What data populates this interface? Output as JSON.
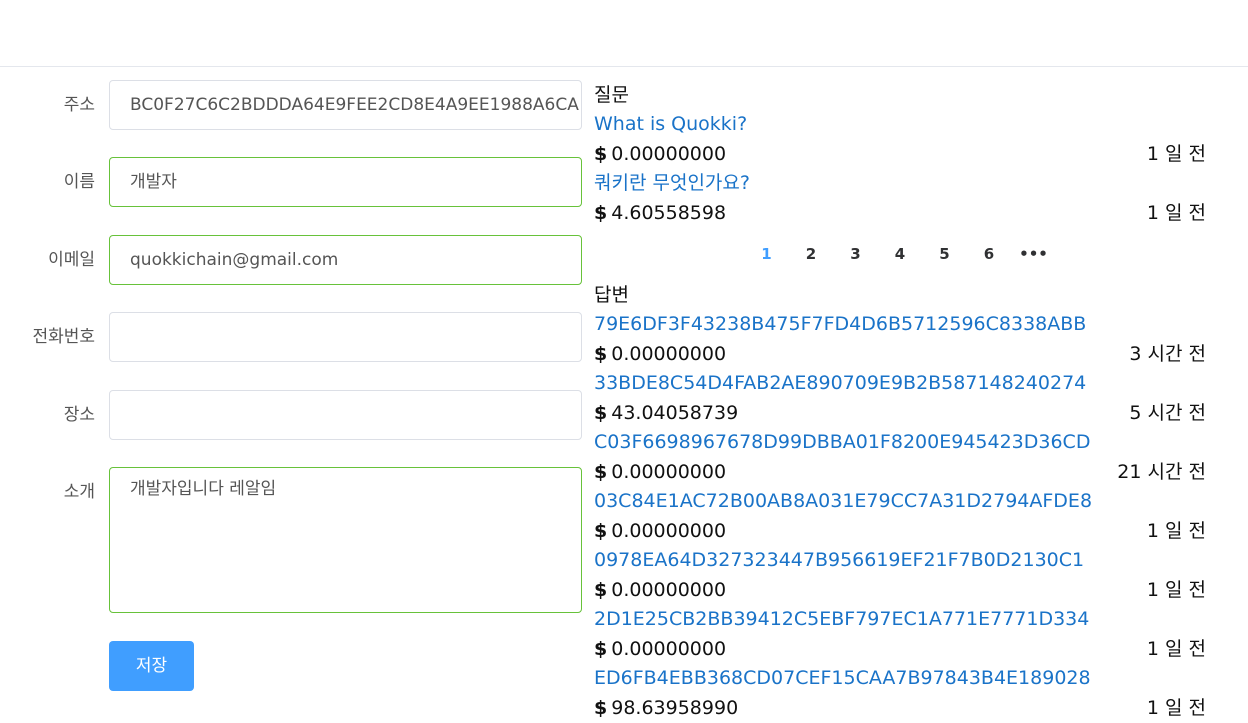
{
  "form": {
    "address_label": "주소",
    "address_value": "BC0F27C6C2BDDDA64E9FEE2CD8E4A9EE1988A6CA",
    "name_label": "이름",
    "name_value": "개발자",
    "email_label": "이메일",
    "email_value": "quokkichain@gmail.com",
    "phone_label": "전화번호",
    "phone_value": "",
    "place_label": "장소",
    "place_value": "",
    "intro_label": "소개",
    "intro_value": "개발자입니다 레알임",
    "save_label": "저장"
  },
  "questions": {
    "title": "질문",
    "items": [
      {
        "title": "What is Quokki?",
        "amount": "0.00000000",
        "time": "1 일 전"
      },
      {
        "title": "쿼키란 무엇인가요?",
        "amount": "4.60558598",
        "time": "1 일 전"
      }
    ]
  },
  "pagination": {
    "pages": [
      "1",
      "2",
      "3",
      "4",
      "5",
      "6",
      "•••"
    ],
    "active": "1"
  },
  "answers": {
    "title": "답변",
    "items": [
      {
        "title": "79E6DF3F43238B475F7FD4D6B5712596C8338ABB",
        "amount": "0.00000000",
        "time": "3 시간 전"
      },
      {
        "title": "33BDE8C54D4FAB2AE890709E9B2B587148240274",
        "amount": "43.04058739",
        "time": "5 시간 전"
      },
      {
        "title": "C03F6698967678D99DBBA01F8200E945423D36CD",
        "amount": "0.00000000",
        "time": "21 시간 전"
      },
      {
        "title": "03C84E1AC72B00AB8A031E79CC7A31D2794AFDE8",
        "amount": "0.00000000",
        "time": "1 일 전"
      },
      {
        "title": "0978EA64D327323447B956619EF21F7B0D2130C1",
        "amount": "0.00000000",
        "time": "1 일 전"
      },
      {
        "title": "2D1E25CB2BB39412C5EBF797EC1A771E7771D334",
        "amount": "0.00000000",
        "time": "1 일 전"
      },
      {
        "title": "ED6FB4EBB368CD07CEF15CAA7B97843B4E189028",
        "amount": "98.63958990",
        "time": "1 일 전"
      }
    ]
  },
  "currency_symbol": "$"
}
